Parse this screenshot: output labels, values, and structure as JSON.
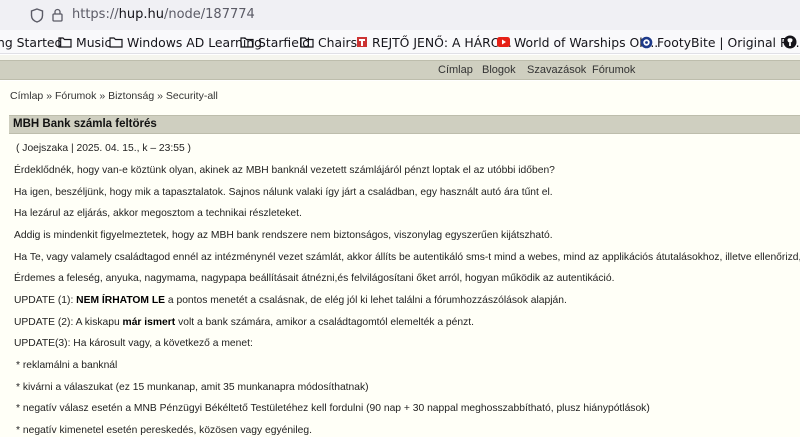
{
  "browser": {
    "url_scheme": "https://",
    "url_host": "hup.hu",
    "url_path": "/node/187774",
    "bookmarks": [
      {
        "label": "ng Started",
        "icon": "firefox-icon"
      },
      {
        "label": "Music",
        "icon": "folder-icon"
      },
      {
        "label": "Windows AD Learning",
        "icon": "folder-icon"
      },
      {
        "label": "Starfield",
        "icon": "folder-icon"
      },
      {
        "label": "Chairs",
        "icon": "folder-icon"
      },
      {
        "label": "REJTŐ JENŐ: A HÁRO...",
        "icon": "book-favicon-icon"
      },
      {
        "label": "World of Warships Ok...",
        "icon": "youtube-icon"
      },
      {
        "label": "FootyBite | Original Re...",
        "icon": "football-icon"
      },
      {
        "label": "",
        "icon": "github-icon"
      }
    ]
  },
  "nav": {
    "items": [
      "Címlap",
      "Blogok",
      "Szavazások",
      "Fórumok"
    ]
  },
  "breadcrumb": {
    "items": [
      "Címlap",
      "Fórumok",
      "Biztonság",
      "Security-all"
    ],
    "separator": "»"
  },
  "post": {
    "title": "MBH Bank számla feltörés",
    "meta": "( Joejszaka | 2025. 04. 15., k – 23:55 )",
    "p1": "Érdeklődnék, hogy van-e köztünk olyan, akinek az MBH banknál vezetett számlájáról pénzt loptak el az utóbbi időben?",
    "p2": "Ha igen, beszéljünk, hogy mik a tapasztalatok. Sajnos nálunk valaki így járt a családban, egy használt autó ára tűnt el.",
    "p3": "Ha lezárul az eljárás, akkor megosztom a technikai részleteket.",
    "p4": "Addig is mindenkit figyelmeztetek, hogy az MBH bank rendszere nem biztonságos, viszonylag egyszerűen kijátszható.",
    "p5": "Ha Te, vagy valamely családtagod ennél az intézménynél vezet számlát, akkor állíts be autentikáló sms-t mind a webes, mind az applikációs átutalásokhoz, illetve ellenőrizd, hogy be van-e ilyen állítva.",
    "p6": "Érdemes a feleség, anyuka, nagymama, nagypapa beállításait átnézni,és felvilágosítani őket arról, hogyan működik az autentikáció.",
    "update1": {
      "prefix": "UPDATE (1): ",
      "bold": "NEM ÍRHATOM LE",
      "suffix": " a pontos menetét a csalásnak, de elég jól ki lehet találni a fórumhozzászólások alapján."
    },
    "update2": {
      "prefix": "UPDATE (2): A kiskapu ",
      "bold": "már ismert",
      "suffix": " volt a bank számára, amikor a családtagomtól elemelték a pénzt."
    },
    "update3": "UPDATE(3): Ha károsult vagy, a következő a menet:",
    "bullets": [
      "* reklamálni a banknál",
      "* kivárni a válaszukat (ez 15 munkanap, amit 35 munkanapra módosíthatnak)",
      "* negatív válasz esetén a MNB Pénzügyi Békéltető Testületéhez kell fordulni (90 nap + 30 nappal meghosszabbítható, plusz hiánypótlások)",
      "* negatív kimenetel esetén pereskedés, közösen vagy egyénileg."
    ]
  }
}
